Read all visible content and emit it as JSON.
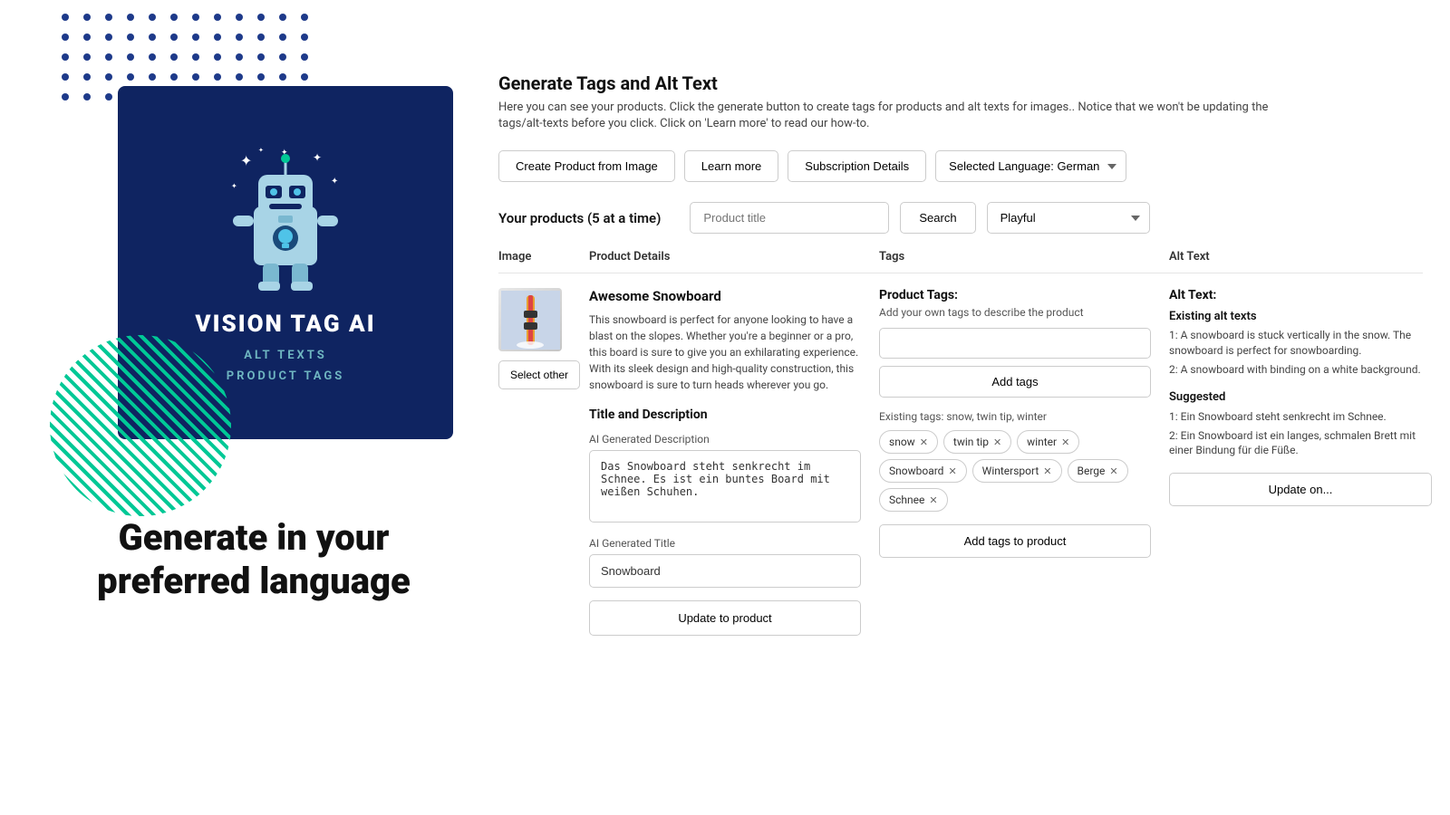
{
  "page": {
    "title": "Generate Tags and Alt Text",
    "description": "Here you can see your products. Click the generate button to create tags for products and alt texts for images.. Notice that we won't be updating the tags/alt-texts before you click. Click on 'Learn more' to read our how-to."
  },
  "toolbar": {
    "create_btn": "Create Product from Image",
    "learn_more_btn": "Learn more",
    "subscription_btn": "Subscription Details",
    "language_label": "Selected Language: German"
  },
  "products_bar": {
    "label": "Your products (5 at a time)",
    "search_placeholder": "Product title",
    "search_btn": "Search",
    "style_value": "Playful"
  },
  "table": {
    "headers": [
      "Image",
      "Product Details",
      "Tags",
      "Alt Text"
    ]
  },
  "product": {
    "name": "Awesome Snowboard",
    "description": "This snowboard is perfect for anyone looking to have a blast on the slopes. Whether you're a beginner or a pro, this board is sure to give you an exhilarating experience. With its sleek design and high-quality construction, this snowboard is sure to turn heads wherever you go.",
    "title_and_desc_section": "Title and Description",
    "ai_desc_label": "AI Generated Description",
    "ai_desc_value": "Das Snowboard steht senkrecht im Schnee. Es ist ein buntes Board mit weißen Schuhen.",
    "ai_title_label": "AI Generated Title",
    "ai_title_value": "Snowboard",
    "update_btn": "Update to product",
    "select_other_btn": "Select other"
  },
  "tags": {
    "section_title": "Product Tags:",
    "section_desc": "Add your own tags to describe the product",
    "add_btn": "Add tags",
    "existing_label": "Existing tags: snow, twin tip, winter",
    "existing_tags": [
      {
        "label": "snow"
      },
      {
        "label": "twin tip"
      },
      {
        "label": "winter"
      }
    ],
    "suggested_tags": [
      {
        "label": "Snowboard"
      },
      {
        "label": "Wintersport"
      },
      {
        "label": "Berge"
      },
      {
        "label": "Schnee"
      }
    ],
    "add_to_product_btn": "Add tags to product"
  },
  "alt_text": {
    "section_title": "Alt Text:",
    "existing_label": "Existing alt texts",
    "existing": [
      "1: A snowboard is stuck vertically in the snow. The snowboard is perfect for snowboarding.",
      "2: A snowboard with binding on a white background."
    ],
    "suggested_label": "Suggested",
    "suggested": [
      "1: Ein Snowboard steht senkrecht im Schnee.",
      "2: Ein Snowboard ist ein langes, schmalen Brett mit einer Bindung für die Füße."
    ],
    "update_btn": "Update on..."
  },
  "logo": {
    "title": "VISION TAG AI",
    "subtitle_line1": "ALT TEXTS",
    "subtitle_line2": "PRODUCT TAGS"
  },
  "tagline": "Generate in your preferred language"
}
